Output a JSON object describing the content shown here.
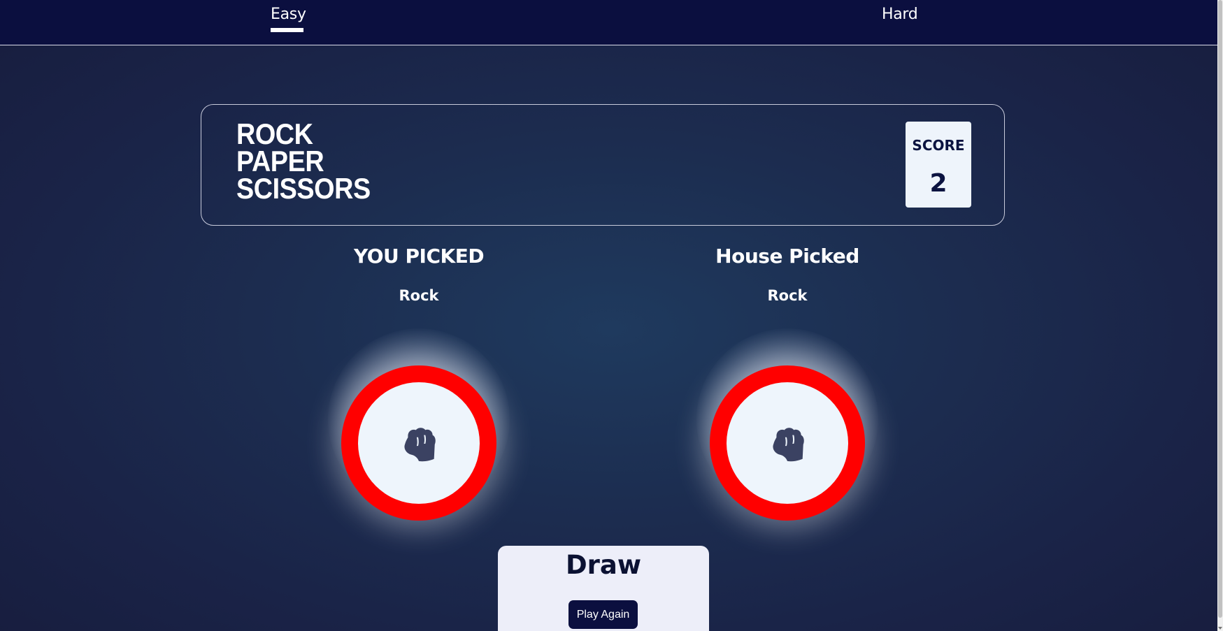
{
  "nav": {
    "tabs": [
      {
        "label": "Easy",
        "active": true
      },
      {
        "label": "Hard",
        "active": false
      }
    ]
  },
  "header": {
    "title_lines": [
      "ROCK",
      "PAPER",
      "SCISSORS"
    ],
    "score_label": "SCORE",
    "score_value": "2"
  },
  "player": {
    "heading": "YOU PICKED",
    "choice": "Rock",
    "icon": "rock-fist-icon"
  },
  "house": {
    "heading": "House Picked",
    "choice": "Rock",
    "icon": "rock-fist-icon"
  },
  "result": {
    "text": "Draw",
    "play_again_label": "Play Again"
  },
  "colors": {
    "nav_bg": "#0b0f3f",
    "token_ring": "#ff0000",
    "token_face": "#eef5fc",
    "icon_fill": "#3b4262",
    "score_text": "#0b1340"
  }
}
